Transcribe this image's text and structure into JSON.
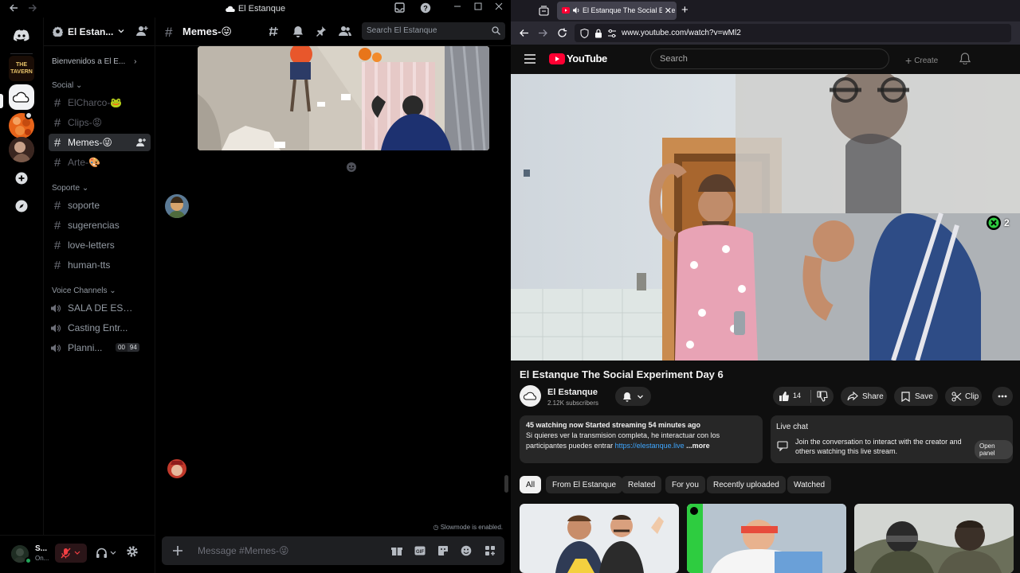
{
  "discord": {
    "window_title": "El Estanque",
    "server": {
      "name": "El Estan..."
    },
    "servers": [
      {
        "label": "THE TAVERN"
      },
      {
        "label": "add-server"
      },
      {
        "label": "discover"
      }
    ],
    "sidebar": {
      "welcome": "Bienvenidos a El E...",
      "categories": {
        "social": "Social",
        "support": "Soporte",
        "voice": "Voice Channels"
      },
      "social_channels": [
        {
          "label": "ElCharco-🐸"
        },
        {
          "label": "Clips-😡"
        },
        {
          "label": "Memes-😜"
        },
        {
          "label": "Arte-🎨"
        }
      ],
      "support_channels": [
        {
          "label": "soporte"
        },
        {
          "label": "sugerencias"
        },
        {
          "label": "love-letters"
        },
        {
          "label": "human-tts"
        }
      ],
      "voice_channels": [
        {
          "label": "SALA DE ESPE..."
        },
        {
          "label": "Casting Entr..."
        },
        {
          "label": "Planni..."
        }
      ],
      "voice_badge_a": "00",
      "voice_badge_b": "94"
    },
    "user": {
      "name": "S...",
      "status": "On..."
    },
    "chat": {
      "channel": "Memes-😜",
      "search_placeholder": "Search El Estanque",
      "composer_placeholder": "Message #Memes-😜",
      "slowmode": "Slowmode is enabled."
    }
  },
  "browser": {
    "tab_title": "El Estanque The Social Expe",
    "url": "www.youtube.com/watch?v=wMl2"
  },
  "youtube": {
    "logo": "YouTube",
    "search_placeholder": "Search",
    "create_label": "Create",
    "viewer_badge": "2",
    "title": "El Estanque The Social Experiment Day 6",
    "channel": {
      "name": "El Estanque",
      "subscribers": "2.12K subscribers"
    },
    "actions": {
      "likes": "14",
      "share": "Share",
      "save": "Save",
      "clip": "Clip"
    },
    "description": {
      "stats": "45 watching now  Started streaming 54 minutes ago",
      "line1": "Si quieres ver la transmision completa, he interactuar con los",
      "line2_prefix": "participantes puedes entrar ",
      "link": "https://elestanque.live",
      "more": " ...more"
    },
    "livechat": {
      "title": "Live chat",
      "text": "Join the conversation to interact with the creator and others watching this live stream.",
      "button": "Open panel"
    },
    "chips": [
      "All",
      "From El Estanque",
      "Related",
      "For you",
      "Recently uploaded",
      "Watched"
    ]
  }
}
